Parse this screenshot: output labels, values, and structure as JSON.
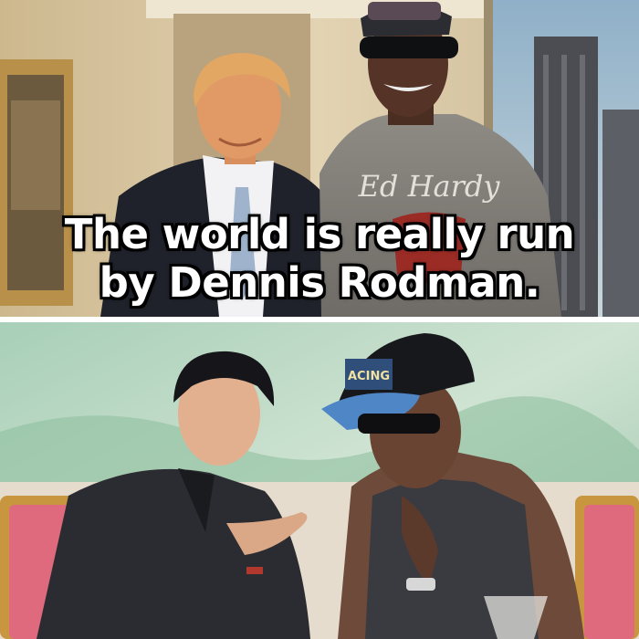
{
  "meme": {
    "caption_line1": "The world is really run",
    "caption_line2": "by Dennis Rodman."
  },
  "shirt_print": "Ed Hardy",
  "cap_print": "ACING",
  "colors": {
    "caption_text": "#ffffff",
    "caption_outline": "#000000",
    "divider": "#ffffff"
  }
}
